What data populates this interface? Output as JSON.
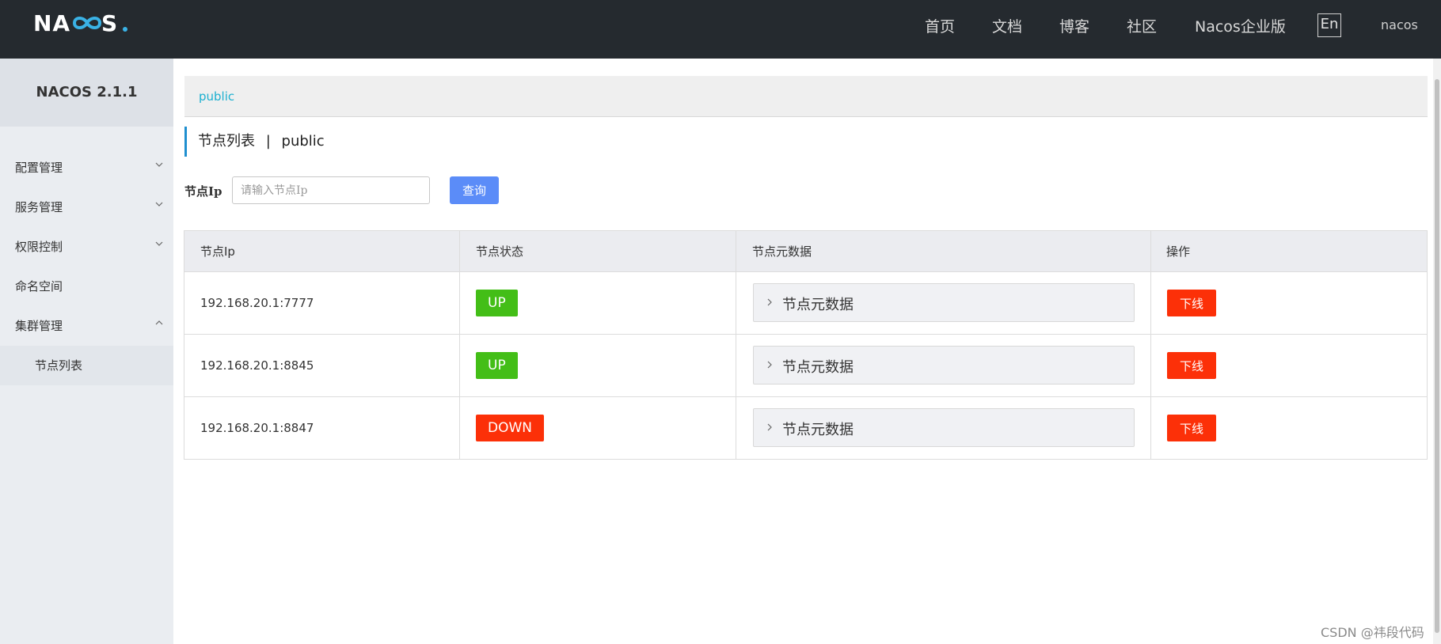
{
  "header": {
    "logo": "NACOS.",
    "nav": [
      "首页",
      "文档",
      "博客",
      "社区",
      "Nacos企业版"
    ],
    "lang_toggle": "En",
    "user": "nacos"
  },
  "sidebar": {
    "title": "NACOS 2.1.1",
    "items": [
      {
        "label": "配置管理",
        "expanded": false
      },
      {
        "label": "服务管理",
        "expanded": false
      },
      {
        "label": "权限控制",
        "expanded": false
      },
      {
        "label": "命名空间"
      },
      {
        "label": "集群管理",
        "expanded": true
      }
    ],
    "subitem": "节点列表"
  },
  "breadcrumb": "public",
  "page_title": {
    "main": "节点列表",
    "separator": "|",
    "namespace": "public"
  },
  "filter": {
    "label": "节点Ip",
    "placeholder": "请输入节点Ip",
    "value": "",
    "query_button": "查询"
  },
  "table": {
    "columns": [
      "节点Ip",
      "节点状态",
      "节点元数据",
      "操作"
    ],
    "rows": [
      {
        "ip": "192.168.20.1:7777",
        "status": "UP",
        "metadata": "节点元数据",
        "action": "下线"
      },
      {
        "ip": "192.168.20.1:8845",
        "status": "UP",
        "metadata": "节点元数据",
        "action": "下线"
      },
      {
        "ip": "192.168.20.1:8847",
        "status": "DOWN",
        "metadata": "节点元数据",
        "action": "下线"
      }
    ]
  },
  "colors": {
    "header_bg": "#252a2f",
    "sidebar_bg": "#eaedf1",
    "up": "#43be17",
    "down": "#fc3008",
    "primary": "#5b8cf8",
    "accent": "#1cb0d0"
  },
  "watermark": "CSDN @祎段代码"
}
